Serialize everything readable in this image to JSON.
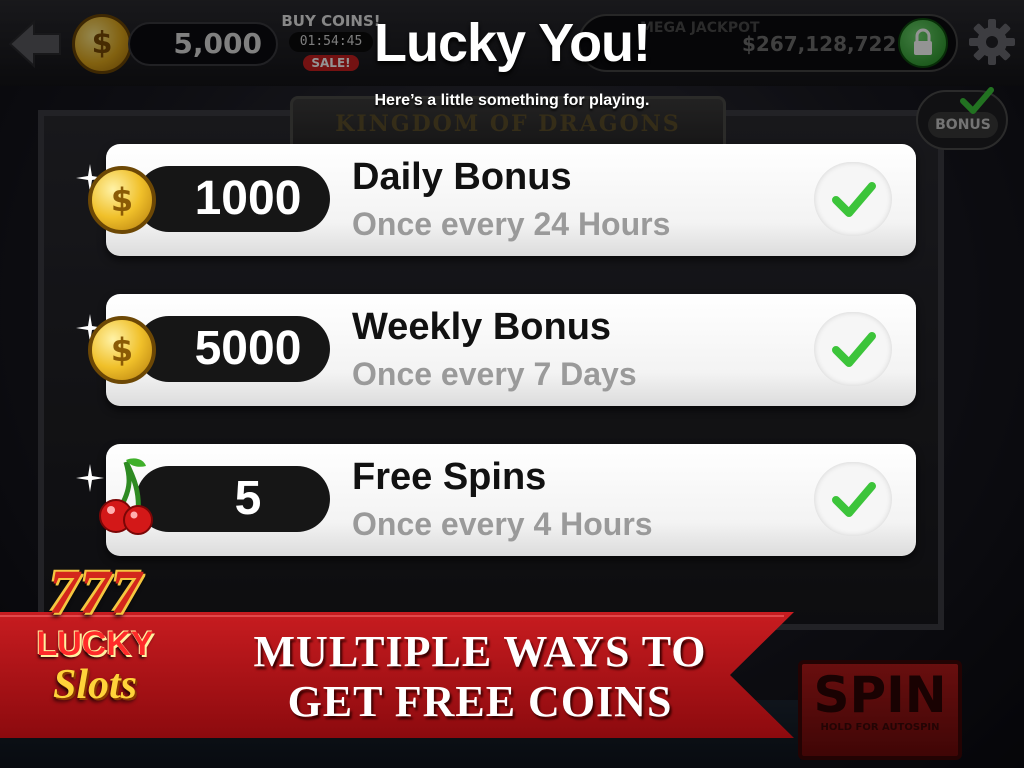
{
  "topbar": {
    "balance": "5,000",
    "buy_coins_label": "BUY COINS!",
    "timer": "01:54:45",
    "sale_label": "SALE!",
    "jackpot_label": "MEGA JACKPOT",
    "jackpot_value": "$267,128,722",
    "coin_symbol": "$"
  },
  "game": {
    "reel_title": "KINGDOM OF DRAGONS",
    "bonus_label": "BONUS",
    "spin_label": "SPIN",
    "spin_sub": "HOLD FOR AUTOSPIN"
  },
  "dialog": {
    "title": "Lucky You!",
    "subtitle": "Here’s a little something for playing.",
    "rows": [
      {
        "amount": "1000",
        "name": "Daily Bonus",
        "frequency": "Once every 24 Hours",
        "icon": "coin-icon",
        "claimed": true
      },
      {
        "amount": "5000",
        "name": "Weekly Bonus",
        "frequency": "Once every 7 Days",
        "icon": "coin-icon",
        "claimed": true
      },
      {
        "amount": "5",
        "name": "Free Spins",
        "frequency": "Once every 4 Hours",
        "icon": "cherry-icon",
        "claimed": true
      }
    ]
  },
  "promo": {
    "line1": "MULTIPLE WAYS TO",
    "line2": "GET FREE COINS",
    "logo_777": "777",
    "logo_lucky": "LUCKY",
    "logo_slots": "Slots"
  },
  "colors": {
    "check_green": "#3cc43a",
    "banner_red": "#b4141a",
    "coin_gold": "#f0c02a"
  }
}
